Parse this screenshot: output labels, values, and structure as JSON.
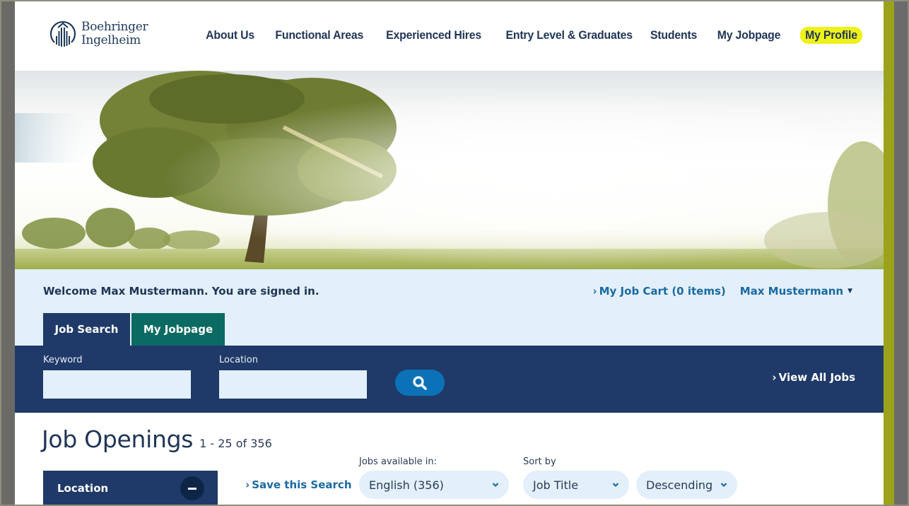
{
  "brand": {
    "name_line1": "Boehringer",
    "name_line2": "Ingelheim",
    "logo_icon": "boehringer-logo-icon"
  },
  "nav": {
    "items": [
      {
        "label": "About Us"
      },
      {
        "label": "Functional Areas"
      },
      {
        "label": "Experienced Hires"
      },
      {
        "label": "Entry Level & Graduates"
      },
      {
        "label": "Students"
      },
      {
        "label": "My Jobpage"
      },
      {
        "label": "My Profile",
        "highlighted": true
      }
    ]
  },
  "hero": {
    "image": "tree-in-meadow-photo"
  },
  "account": {
    "welcome": "Welcome Max Mustermann. You are signed in.",
    "cart_link": "My Job Cart (0 items)",
    "user_name": "Max Mustermann",
    "chevron_glyph": "›",
    "caret_glyph": "▼"
  },
  "tabs": [
    {
      "label": "Job Search",
      "active": true
    },
    {
      "label": "My Jobpage",
      "active": false
    }
  ],
  "search": {
    "keyword_label": "Keyword",
    "keyword_value": "",
    "location_label": "Location",
    "location_value": "",
    "search_icon": "search-icon",
    "view_all": "View All Jobs"
  },
  "results": {
    "title": "Job Openings",
    "count": "1 - 25 of 356",
    "filter_panel_label": "Location",
    "save_search": "Save this Search",
    "language_label": "Jobs available in:",
    "language_value": "English (356)",
    "sort_label": "Sort by",
    "sort_field_value": "Job Title",
    "sort_order_value": "Descending"
  },
  "colors": {
    "navy": "#1f3a68",
    "teal": "#0b6a62",
    "link_blue": "#1a6aa0",
    "highlight_yellow": "#eef21a",
    "light_blue_bg": "#e3f0fb",
    "search_button": "#0b72b8",
    "olive_stripe": "#9ca31b"
  }
}
